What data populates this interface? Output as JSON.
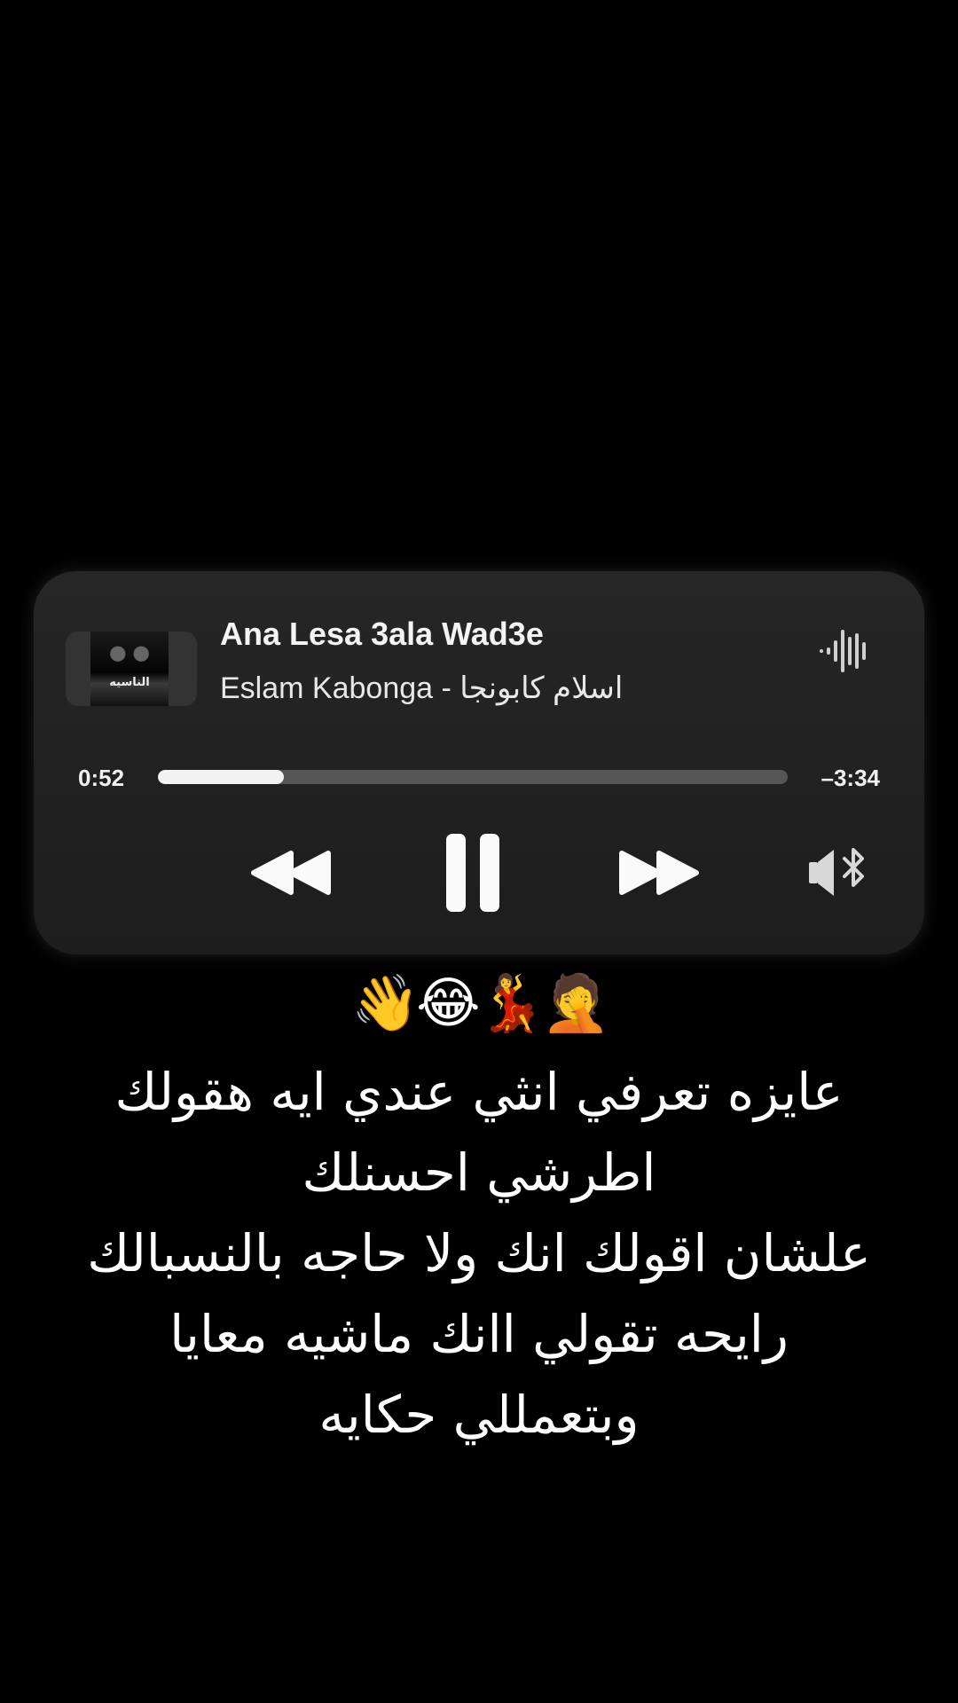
{
  "player": {
    "title": "Ana Lesa 3ala Wad3e",
    "artist": "Eslam Kabonga - اسلام كابونجا",
    "artwork_text": "الناسيه",
    "elapsed": "0:52",
    "remaining": "–3:34",
    "progress_fraction": 0.2,
    "icons": {
      "waveform": "waveform-icon",
      "rewind": "rewind-icon",
      "pause": "pause-icon",
      "forward": "fast-forward-icon",
      "audio_output": "speaker-bluetooth-icon"
    }
  },
  "caption": {
    "emojis": "👋😂💃🤦",
    "lines": [
      "عايزه تعرفي انثي عندي ايه هقولك",
      "اطرشي احسنلك",
      "علشان اقولك انك ولا حاجه بالنسبالك",
      "رايحه تقولي اانك ماشيه معايا",
      "وبتعمللي حكايه"
    ]
  },
  "colors": {
    "background": "#000000",
    "card": "#222222",
    "accent": "#f2f2f2"
  }
}
